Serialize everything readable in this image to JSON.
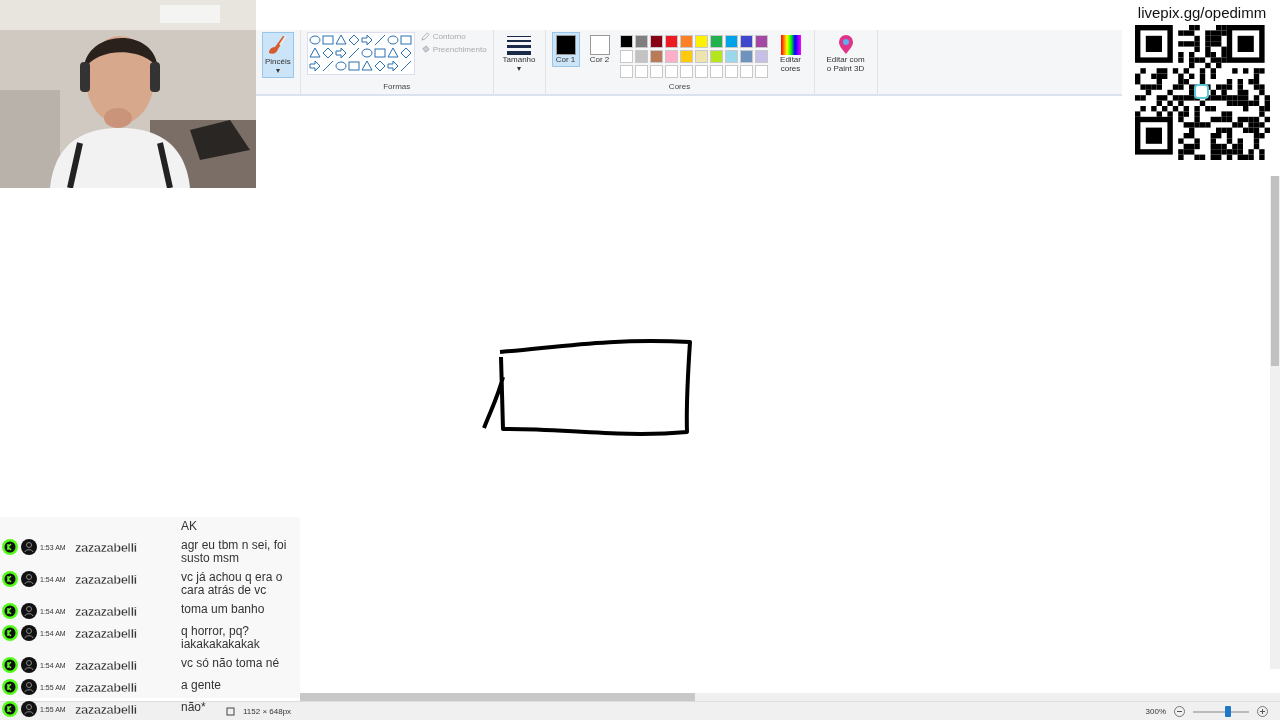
{
  "ribbon": {
    "brushes": {
      "label": "Pincéis",
      "caret": "▾"
    },
    "shapes": {
      "outline": "Contorno",
      "fill": "Preenchimento",
      "group_label": "Formas"
    },
    "size": {
      "label": "Tamanho",
      "caret": "▾"
    },
    "color_slots": [
      {
        "label": "Cor 1",
        "color": "#000000",
        "selected": true
      },
      {
        "label": "Cor 2",
        "color": "#ffffff",
        "selected": false
      }
    ],
    "palette": [
      {
        "color": "#000000"
      },
      {
        "color": "#7f7f7f"
      },
      {
        "color": "#880015"
      },
      {
        "color": "#ed1c24"
      },
      {
        "color": "#ff7f27"
      },
      {
        "color": "#fff200"
      },
      {
        "color": "#22b14c"
      },
      {
        "color": "#00a2e8"
      },
      {
        "color": "#3f48cc"
      },
      {
        "color": "#a349a4"
      },
      {
        "color": "#ffffff"
      },
      {
        "color": "#c3c3c3"
      },
      {
        "color": "#b97a57"
      },
      {
        "color": "#ffaec9"
      },
      {
        "color": "#ffc90e"
      },
      {
        "color": "#efe4b0"
      },
      {
        "color": "#b5e61d"
      },
      {
        "color": "#99d9ea"
      },
      {
        "color": "#7092be"
      },
      {
        "color": "#c8bfe7"
      }
    ],
    "edit_colors": "Editar cores",
    "paint3d": "Editar com o Paint 3D",
    "colors_label": "Cores"
  },
  "donation": {
    "url": "livepix.gg/opedimm"
  },
  "chat": [
    {
      "kind": "partial",
      "text": "AK"
    },
    {
      "kind": "message",
      "time": "1:53 AM",
      "user": "zazazabelli",
      "text": "agr eu tbm n sei, foi susto msm"
    },
    {
      "kind": "message",
      "time": "1:54 AM",
      "user": "zazazabelli",
      "text": "vc já achou q era o cara atrás de vc"
    },
    {
      "kind": "message",
      "time": "1:54 AM",
      "user": "zazazabelli",
      "text": "toma um banho"
    },
    {
      "kind": "message",
      "time": "1:54 AM",
      "user": "zazazabelli",
      "text": "q horror, pq? iakakakakakak"
    },
    {
      "kind": "message",
      "time": "1:54 AM",
      "user": "zazazabelli",
      "text": "vc só não toma né"
    },
    {
      "kind": "message",
      "time": "1:55 AM",
      "user": "zazazabelli",
      "text": "a gente"
    },
    {
      "kind": "message",
      "time": "1:55 AM",
      "user": "zazazabelli",
      "text": "não*"
    }
  ],
  "status_bar": {
    "canvas_size": "1152 × 648px",
    "zoom": "300%",
    "zoom_level": {
      "level": 0.62
    }
  }
}
